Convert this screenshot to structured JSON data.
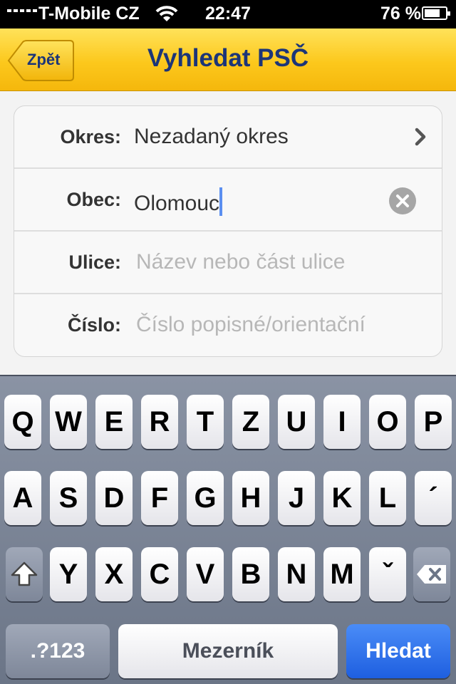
{
  "status_bar": {
    "carrier": "T-Mobile CZ",
    "time": "22:47",
    "battery_percent": "76 %",
    "battery_level": 0.76
  },
  "nav": {
    "back_label": "Zpět",
    "title": "Vyhledat PSČ"
  },
  "form": {
    "district": {
      "label": "Okres:",
      "value": "Nezadaný okres"
    },
    "town": {
      "label": "Obec:",
      "value": "Olomouc"
    },
    "street": {
      "label": "Ulice:",
      "placeholder": "Název nebo část ulice"
    },
    "number": {
      "label": "Číslo:",
      "placeholder": "Číslo popisné/orientační"
    }
  },
  "keyboard": {
    "row1": [
      "Q",
      "W",
      "E",
      "R",
      "T",
      "Z",
      "U",
      "I",
      "O",
      "P"
    ],
    "row2": [
      "A",
      "S",
      "D",
      "F",
      "G",
      "H",
      "J",
      "K",
      "L",
      "´"
    ],
    "row3": [
      "Y",
      "X",
      "C",
      "V",
      "B",
      "N",
      "M",
      "ˇ"
    ],
    "numbers_label": ".?123",
    "space_label": "Mezerník",
    "search_label": "Hledat"
  }
}
